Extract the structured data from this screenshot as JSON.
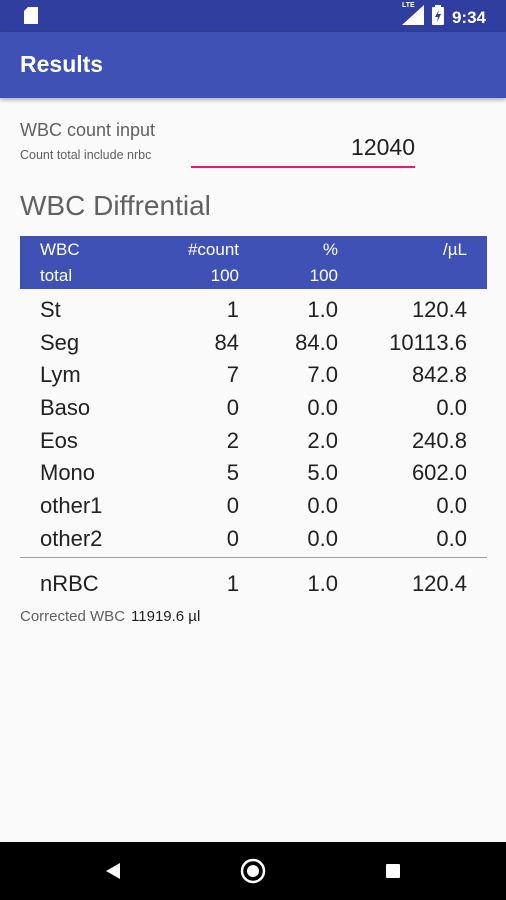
{
  "status_bar": {
    "time": "9:34",
    "network": "LTE",
    "icons": [
      "sd-card-icon",
      "signal-icon",
      "battery-icon"
    ]
  },
  "app_bar": {
    "title": "Results"
  },
  "input": {
    "label": "WBC count input",
    "hint": "Count total include nrbc",
    "value": "12040"
  },
  "section": {
    "title": "WBC Diffrential"
  },
  "table": {
    "header": {
      "row1": [
        "WBC",
        "#count",
        "%",
        "/µL"
      ],
      "row2": [
        "total",
        "100",
        "100",
        ""
      ]
    },
    "rows": [
      [
        "St",
        "1",
        "1.0",
        "120.4"
      ],
      [
        "Seg",
        "84",
        "84.0",
        "10113.6"
      ],
      [
        "Lym",
        "7",
        "7.0",
        "842.8"
      ],
      [
        "Baso",
        "0",
        "0.0",
        "0.0"
      ],
      [
        "Eos",
        "2",
        "2.0",
        "240.8"
      ],
      [
        "Mono",
        "5",
        "5.0",
        "602.0"
      ],
      [
        "other1",
        "0",
        "0.0",
        "0.0"
      ],
      [
        "other2",
        "0",
        "0.0",
        "0.0"
      ]
    ],
    "nrbc": [
      "nRBC",
      "1",
      "1.0",
      "120.4"
    ]
  },
  "corrected": {
    "label": "Corrected WBC",
    "value": "11919.6 µl"
  },
  "nav_bar": {
    "buttons": [
      "back-icon",
      "home-icon",
      "recents-icon"
    ]
  },
  "colors": {
    "primary": "#3f51b5",
    "primary_dark": "#303f9f",
    "accent": "#e91e63"
  }
}
